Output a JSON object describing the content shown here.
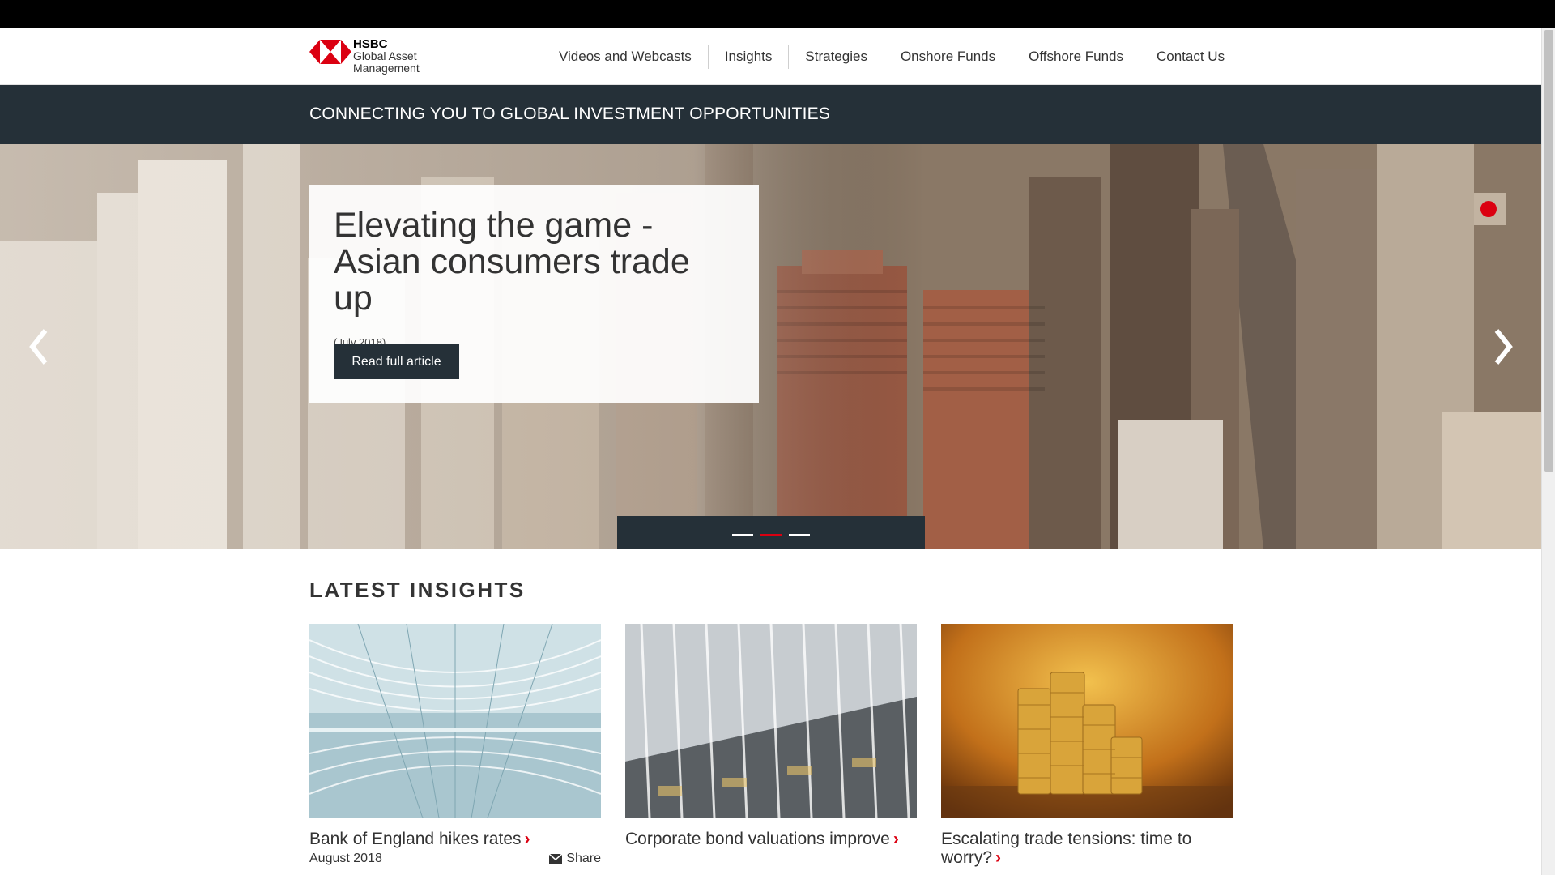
{
  "header": {
    "logo": {
      "brand": "HSBC",
      "line1": "Global Asset",
      "line2": "Management",
      "icon": "hsbc-hexagon-logo"
    },
    "nav": [
      "Videos and Webcasts",
      "Insights",
      "Strategies",
      "Onshore Funds",
      "Offshore Funds",
      "Contact Us"
    ]
  },
  "tagline": "CONNECTING YOU TO GLOBAL INVESTMENT OPPORTUNITIES",
  "hero": {
    "title": "Elevating the game - Asian consumers trade up",
    "date": "(July 2018)",
    "button_label": "Read full article",
    "prev_icon": "chevron-left-icon",
    "next_icon": "chevron-right-icon",
    "slide_count": 3,
    "active_slide": 2
  },
  "insights": {
    "heading": "LATEST INSIGHTS",
    "cards": [
      {
        "title": "Bank of England hikes rates",
        "date": "August 2018",
        "share_label": "Share",
        "image": "airport-terminal-roof"
      },
      {
        "title": "Corporate bond valuations improve",
        "date": "",
        "share_label": "",
        "image": "glass-building-facade"
      },
      {
        "title": "Escalating trade tensions: time to worry?",
        "date": "",
        "share_label": "",
        "image": "gold-coin-stacks"
      }
    ]
  },
  "colors": {
    "brand_red": "#db0011",
    "dark_navy": "#253038",
    "text": "#333333"
  }
}
